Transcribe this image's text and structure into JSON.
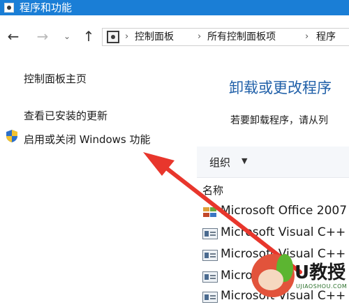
{
  "window": {
    "title": "程序和功能"
  },
  "navigation": {
    "back_icon": "arrow-left-icon",
    "forward_icon": "arrow-right-icon",
    "recent_icon": "chevron-down-icon",
    "up_icon": "arrow-up-icon"
  },
  "address": {
    "icon": "control-panel-icon",
    "crumbs": [
      "控制面板",
      "所有控制面板项",
      "程序"
    ]
  },
  "sidebar": {
    "home_link": "控制面板主页",
    "updates_link": "查看已安装的更新",
    "features_link": "启用或关闭 Windows 功能",
    "features_icon": "shield-icon"
  },
  "main": {
    "heading": "卸载或更改程序",
    "description": "若要卸载程序，请从列",
    "toolbar": {
      "organize_label": "组织"
    },
    "column_header": "名称",
    "programs": [
      {
        "name": "Microsoft Office 2007",
        "icon": "office-icon"
      },
      {
        "name": "Microsoft Visual C++",
        "icon": "program-icon"
      },
      {
        "name": "Microsoft Visual C++",
        "icon": "program-icon"
      },
      {
        "name": "Micro",
        "icon": "program-icon"
      },
      {
        "name": "Microsoft Visual C++",
        "icon": "program-icon"
      }
    ]
  },
  "annotation": {
    "arrow_color": "#e8362c"
  },
  "watermark": {
    "text": "U教授",
    "sub": "UJIAOSHOU.COM"
  },
  "colors": {
    "titlebar": "#1a7ed6",
    "heading": "#1f5fa8"
  }
}
